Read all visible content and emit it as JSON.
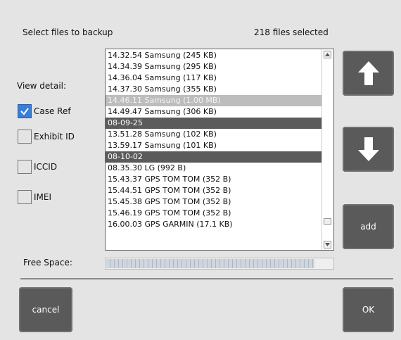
{
  "header": {
    "title": "Select files to backup",
    "selection_count": "218 files selected"
  },
  "view_detail": {
    "label": "View detail:",
    "options": [
      {
        "label": "Case Ref",
        "checked": true
      },
      {
        "label": "Exhibit ID",
        "checked": false
      },
      {
        "label": "ICCID",
        "checked": false
      },
      {
        "label": "IMEI",
        "checked": false
      }
    ]
  },
  "file_list": {
    "rows": [
      {
        "text": "14.32.54 Samsung (245 KB)",
        "style": "normal"
      },
      {
        "text": "14.34.39 Samsung (295 KB)",
        "style": "normal"
      },
      {
        "text": "14.36.04 Samsung (117 KB)",
        "style": "normal"
      },
      {
        "text": "14.37.30 Samsung (355 KB)",
        "style": "normal"
      },
      {
        "text": "14.46.11 Samsung (1.00 MB)",
        "style": "faded"
      },
      {
        "text": "14.49.47 Samsung (306 KB)",
        "style": "normal"
      },
      {
        "text": "08-09-25",
        "style": "header"
      },
      {
        "text": "13.51.28 Samsung (102 KB)",
        "style": "normal"
      },
      {
        "text": "13.59.17 Samsung (101 KB)",
        "style": "normal"
      },
      {
        "text": "08-10-02",
        "style": "header"
      },
      {
        "text": "08.35.30 LG (992  B)",
        "style": "normal"
      },
      {
        "text": "15.43.37 GPS TOM TOM (352  B)",
        "style": "normal"
      },
      {
        "text": "15.44.51 GPS TOM TOM (352  B)",
        "style": "normal"
      },
      {
        "text": "15.45.38 GPS TOM TOM (352  B)",
        "style": "normal"
      },
      {
        "text": "15.46.19 GPS TOM TOM (352  B)",
        "style": "normal"
      },
      {
        "text": "16.00.03 GPS GARMIN (17.1 KB)",
        "style": "normal"
      }
    ]
  },
  "buttons": {
    "up_icon": "arrow-up-icon",
    "down_icon": "arrow-down-icon",
    "add": "add",
    "cancel": "cancel",
    "ok": "OK"
  },
  "free_space": {
    "label": "Free Space:",
    "used_fraction": 0.92
  },
  "colors": {
    "checked": "#3a7fd6",
    "button": "#5a5a5a",
    "date_header": "#5b5b5b"
  }
}
